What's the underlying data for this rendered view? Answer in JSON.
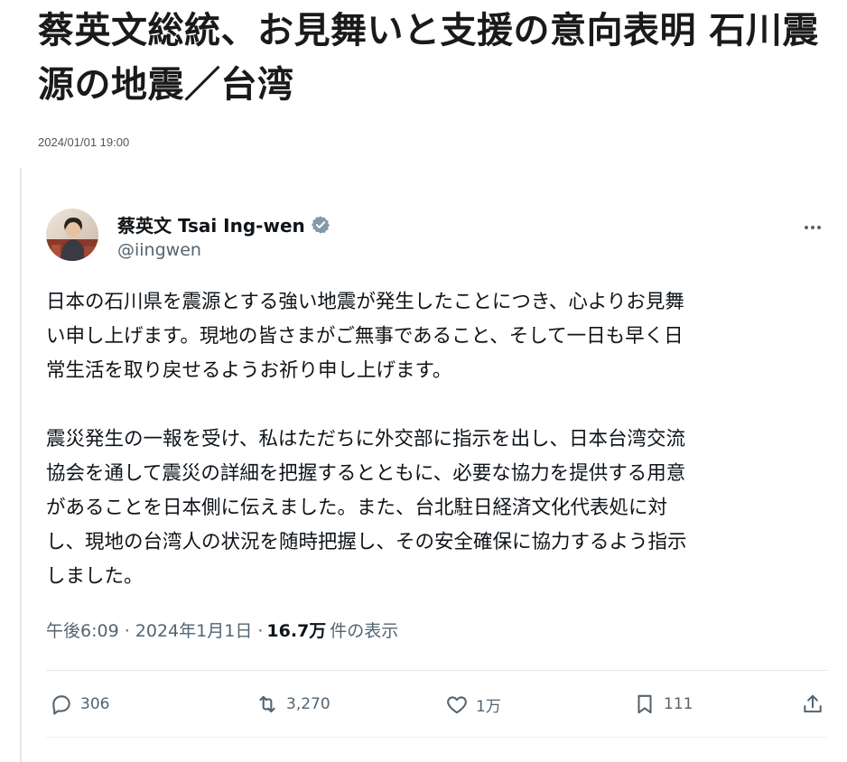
{
  "article": {
    "title": "蔡英文総統、お見舞いと支援の意向表明 石川震源の地震／台湾",
    "date": "2024/01/01 19:00"
  },
  "tweet": {
    "author_name": "蔡英文 Tsai Ing-wen",
    "author_handle": "@iingwen",
    "paragraphs": [
      "日本の石川県を震源とする強い地震が発生したことにつき、心よりお見舞\nい申し上げます。現地の皆さまがご無事であること、そして一日も早く日\n常生活を取り戻せるようお祈り申し上げます。",
      "震災発生の一報を受け、私はただちに外交部に指示を出し、日本台湾交流\n協会を通して震災の詳細を把握するとともに、必要な協力を提供する用意\nがあることを日本側に伝えました。また、台北駐日経済文化代表処に対\nし、現地の台湾人の状況を随時把握し、その安全確保に協力するよう指示\nしました。"
    ],
    "time": "午後6:09 · 2024年1月1日 ·",
    "views_count": "16.7万",
    "views_label": "件の表示",
    "stats": {
      "replies": "306",
      "retweets": "3,270",
      "likes": "1万",
      "bookmarks": "111"
    }
  },
  "icons": {
    "verified": "verified-badge-icon",
    "more": "more-dots-icon",
    "reply": "reply-icon",
    "retweet": "retweet-icon",
    "like": "heart-icon",
    "bookmark": "bookmark-icon",
    "share": "share-icon"
  },
  "colors": {
    "text_primary": "#0f1419",
    "text_secondary": "#536471",
    "verified_badge": "#829aab"
  }
}
